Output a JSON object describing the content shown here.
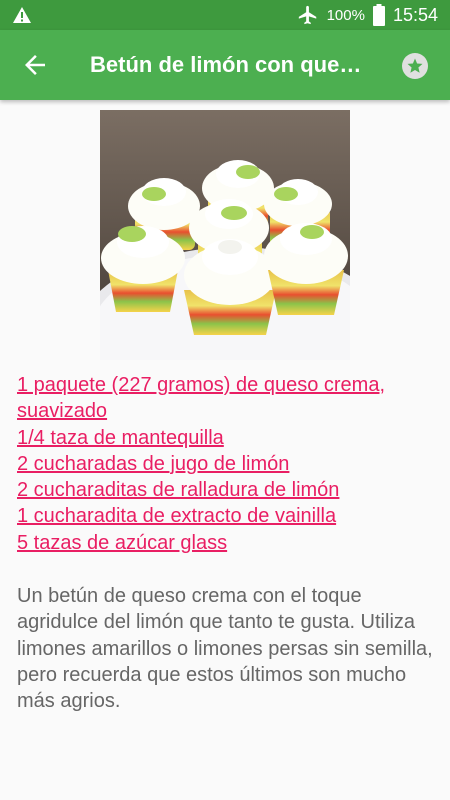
{
  "status_bar": {
    "battery_percent": "100%",
    "time": "15:54",
    "icons": [
      "warning-icon",
      "airplane-mode-icon",
      "battery-icon"
    ]
  },
  "app_bar": {
    "title": "Betún de limón con queso crema",
    "back_icon": "arrow-back-icon",
    "favorite_icon": "star-icon",
    "background_color": "#4caf50",
    "status_bar_color": "#3e9a3e"
  },
  "recipe": {
    "image_description_icon": "cupcakes-photo",
    "ingredients": [
      "1 paquete (227 gramos) de queso crema, suavizado",
      "1/4 taza de mantequilla",
      "2 cucharadas de jugo de limón",
      "2 cucharaditas de ralladura de limón",
      "1 cucharadita de extracto de vainilla",
      "5 tazas de azúcar glass"
    ],
    "ingredient_link_color": "#e91e63",
    "description": "Un betún de queso crema con el toque agridulce del limón que tanto te gusta. Utiliza limones amarillos o limones persas sin semilla, pero recuerda que estos últimos son mucho más agrios."
  }
}
